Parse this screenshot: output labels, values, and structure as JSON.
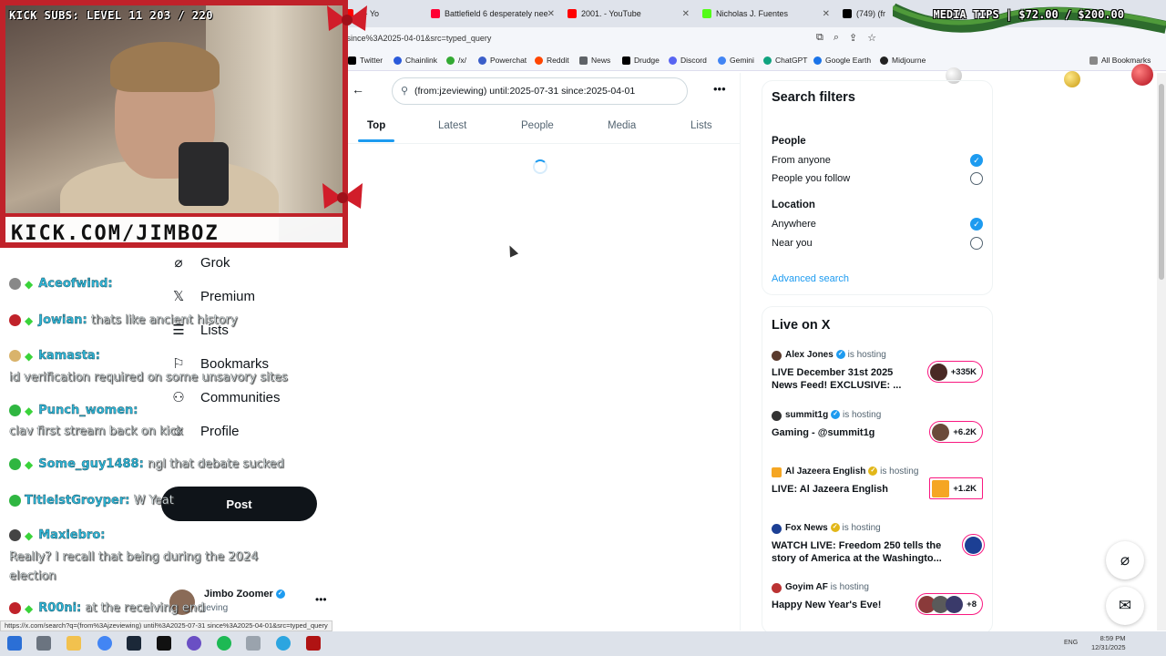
{
  "browser": {
    "tabs": [
      {
        "label": "d - Yo",
        "color": "#ff0000"
      },
      {
        "label": "Battlefield 6 desperately nee",
        "color": "#ff0033"
      },
      {
        "label": "2001. - YouTube",
        "color": "#ff0000"
      },
      {
        "label": "Nicholas J. Fuentes",
        "color": "#53fc18"
      },
      {
        "label": "(749) (fr",
        "color": "#000000"
      }
    ],
    "url": "/since%3A2025-04-01&src=typed_query",
    "bookmarks": [
      "Twitter",
      "Chainlink",
      "/x/",
      "Powerchat",
      "Reddit",
      "News",
      "Drudge",
      "Discord",
      "Gemini",
      "ChatGPT",
      "Google Earth",
      "Midjourne",
      "All Bookmarks"
    ],
    "status_url": "https://x.com/search?q=(from%3Ajzeviewing) until%3A2025-07-31 since%3A2025-04-01&src=typed_query"
  },
  "stream_overlay": {
    "subs": "KICK SUBS: LEVEL 11 203 / 220",
    "banner": "KICK.COM/JIMBOZ",
    "media_tips": "MEDIA TIPS | $72.00 / $200.00"
  },
  "chat": [
    {
      "name": "Aceofwind:",
      "msg": "",
      "badge": "#888888"
    },
    {
      "name": "Jowian:",
      "msg": "thats like ancient history",
      "badge": "#c0222a"
    },
    {
      "name": "kamasta:",
      "msg": "",
      "badge": "#d9b36b"
    },
    {
      "name": "",
      "msg": "id verification required on some unsavory sites",
      "badge": ""
    },
    {
      "name": "Punch_women:",
      "msg": "",
      "badge": "#2fb641"
    },
    {
      "name": "",
      "msg": "clav first stream back on kick",
      "badge": ""
    },
    {
      "name": "Some_guy1488:",
      "msg": "ngl that debate sucked",
      "badge": "#2fb641"
    },
    {
      "name": "TitleistGroyper:",
      "msg": "W Yeat",
      "badge": "#2fb641"
    },
    {
      "name": "Maxiebro:",
      "msg": "",
      "badge": "#444444"
    },
    {
      "name": "",
      "msg": "Really? I recall that being during the 2024",
      "badge": ""
    },
    {
      "name": "",
      "msg": "election",
      "badge": ""
    },
    {
      "name": "R00ni:",
      "msg": "at the receiving end",
      "badge": "#c0222a"
    }
  ],
  "nav": {
    "items": [
      {
        "label": "Grok",
        "icon": "grok-icon",
        "glyph": "⌀"
      },
      {
        "label": "Premium",
        "icon": "x-logo-icon",
        "glyph": "𝕏"
      },
      {
        "label": "Lists",
        "icon": "list-icon",
        "glyph": "☰"
      },
      {
        "label": "Bookmarks",
        "icon": "bookmark-icon",
        "glyph": "⚐"
      },
      {
        "label": "Communities",
        "icon": "communities-icon",
        "glyph": "⚇"
      },
      {
        "label": "Profile",
        "icon": "profile-icon",
        "glyph": "☺"
      }
    ],
    "post_label": "Post",
    "account": {
      "name": "Jimbo Zoomer",
      "handle": "jeving"
    }
  },
  "search": {
    "query": "(from:jzeviewing) until:2025-07-31 since:2025-04-01",
    "tabs": [
      "Top",
      "Latest",
      "People",
      "Media",
      "Lists"
    ],
    "active_tab": "Top"
  },
  "filters": {
    "title": "Search filters",
    "people_head": "People",
    "from_anyone": "From anyone",
    "people_you_follow": "People you follow",
    "location_head": "Location",
    "anywhere": "Anywhere",
    "near_you": "Near you",
    "advanced": "Advanced search"
  },
  "live": {
    "title": "Live on X",
    "items": [
      {
        "host": "Alex Jones",
        "status": "is hosting",
        "text": "LIVE December 31st 2025 News Feed! EXCLUSIVE: ...",
        "count": "+335K",
        "verify": "blue",
        "avatar": "#5a3b2e"
      },
      {
        "host": "summit1g",
        "status": "is hosting",
        "text": "Gaming - @summit1g",
        "count": "+6.2K",
        "verify": "blue",
        "avatar": "#333333"
      },
      {
        "host": "Al Jazeera English",
        "status": "is hosting",
        "text": "LIVE: Al Jazeera English",
        "count": "+1.2K",
        "verify": "gold",
        "avatar": "#f5a623"
      },
      {
        "host": "Fox News",
        "status": "is hosting",
        "text": "WATCH LIVE: Freedom 250 tells the story of America at the Washingto...",
        "count": "",
        "verify": "gold",
        "avatar": "#1c3f94"
      },
      {
        "host": "Goyim AF",
        "status": "is hosting",
        "text": "Happy New Year's Eve!",
        "count": "+8",
        "verify": "",
        "avatar": "#b33"
      }
    ]
  },
  "taskbar": {
    "lang": "ENG",
    "time": "8:59 PM",
    "date": "12/31/2025"
  }
}
